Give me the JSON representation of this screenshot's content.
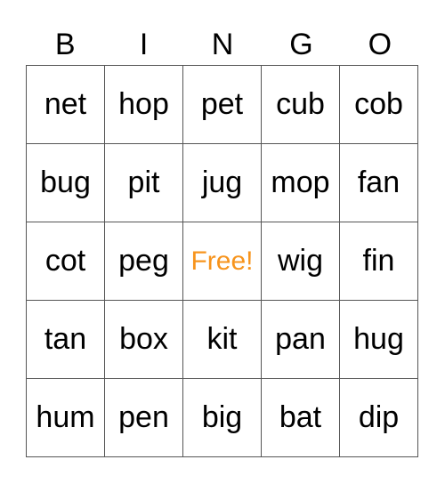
{
  "header": [
    "B",
    "I",
    "N",
    "G",
    "O"
  ],
  "colors": {
    "free": "#f7941d"
  },
  "rows": [
    [
      "net",
      "hop",
      "pet",
      "cub",
      "cob"
    ],
    [
      "bug",
      "pit",
      "jug",
      "mop",
      "fan"
    ],
    [
      "cot",
      "peg",
      "Free!",
      "wig",
      "fin"
    ],
    [
      "tan",
      "box",
      "kit",
      "pan",
      "hug"
    ],
    [
      "hum",
      "pen",
      "big",
      "bat",
      "dip"
    ]
  ]
}
